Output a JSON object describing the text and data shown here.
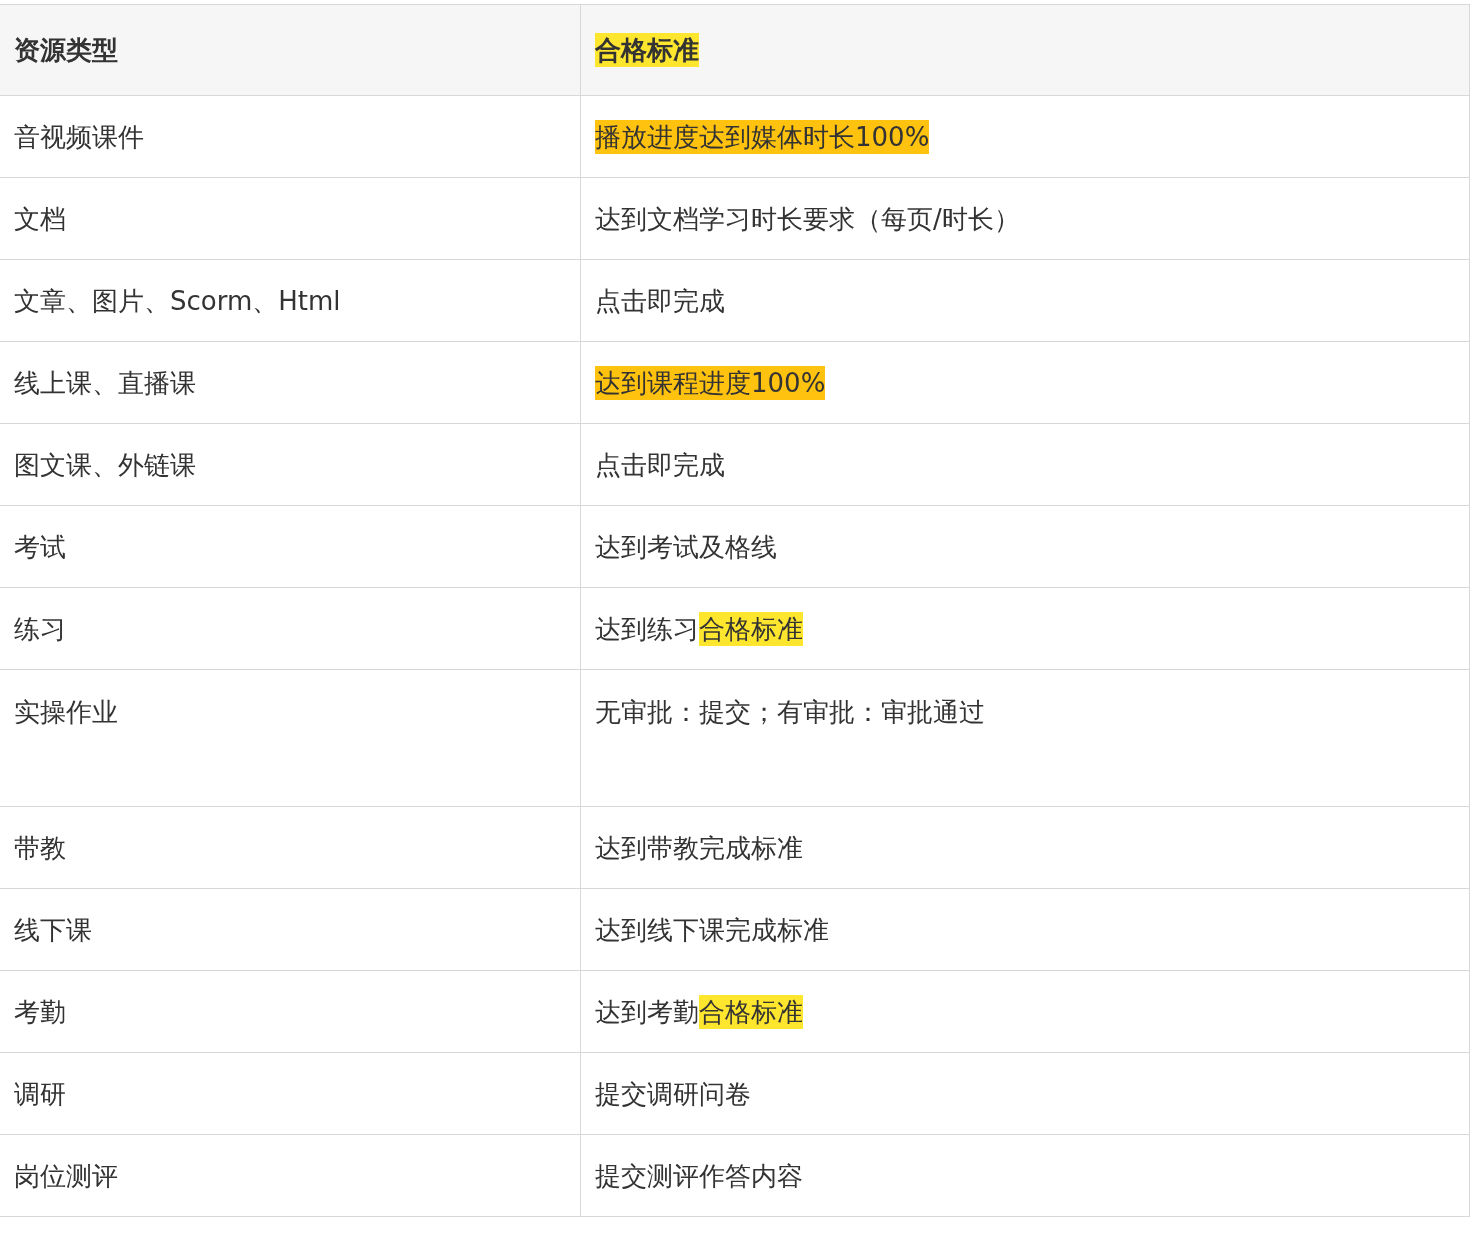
{
  "table": {
    "columns": [
      {
        "segments": [
          {
            "text": "资源类型"
          }
        ]
      },
      {
        "segments": [
          {
            "text": "合格标准",
            "color": "#ffe62e"
          }
        ]
      }
    ],
    "rows": [
      {
        "kind": "normal",
        "cells": [
          [
            {
              "text": "音视频课件"
            }
          ],
          [
            {
              "text": "播放进度达到媒体时长100%",
              "color": "#ffc20e"
            }
          ]
        ]
      },
      {
        "kind": "normal",
        "cells": [
          [
            {
              "text": "文档"
            }
          ],
          [
            {
              "text": "达到文档学习时长要求（每页/时长）"
            }
          ]
        ]
      },
      {
        "kind": "normal",
        "cells": [
          [
            {
              "text": "文章、图片、Scorm、Html"
            }
          ],
          [
            {
              "text": "点击即完成"
            }
          ]
        ]
      },
      {
        "kind": "normal",
        "cells": [
          [
            {
              "text": "线上课、直播课"
            }
          ],
          [
            {
              "text": "达到课程进度100%",
              "color": "#ffc20e"
            }
          ]
        ]
      },
      {
        "kind": "normal",
        "cells": [
          [
            {
              "text": "图文课、外链课"
            }
          ],
          [
            {
              "text": "点击即完成"
            }
          ]
        ]
      },
      {
        "kind": "normal",
        "cells": [
          [
            {
              "text": "考试"
            }
          ],
          [
            {
              "text": "达到考试及格线"
            }
          ]
        ]
      },
      {
        "kind": "normal",
        "cells": [
          [
            {
              "text": "练习"
            }
          ],
          [
            {
              "text": "达到练习"
            },
            {
              "text": "合格标准",
              "color": "#ffe62e"
            }
          ]
        ]
      },
      {
        "kind": "tall",
        "cells": [
          [
            {
              "text": "实操作业"
            }
          ],
          [
            {
              "text": "无审批：提交；有审批：审批通过"
            }
          ]
        ]
      },
      {
        "kind": "normal",
        "cells": [
          [
            {
              "text": "带教"
            }
          ],
          [
            {
              "text": "达到带教完成标准"
            }
          ]
        ]
      },
      {
        "kind": "normal",
        "cells": [
          [
            {
              "text": "线下课"
            }
          ],
          [
            {
              "text": "达到线下课完成标准"
            }
          ]
        ]
      },
      {
        "kind": "normal",
        "cells": [
          [
            {
              "text": "考勤"
            }
          ],
          [
            {
              "text": "达到考勤"
            },
            {
              "text": "合格标准",
              "color": "#ffe62e"
            }
          ]
        ]
      },
      {
        "kind": "normal",
        "cells": [
          [
            {
              "text": "调研"
            }
          ],
          [
            {
              "text": "提交调研问卷"
            }
          ]
        ]
      },
      {
        "kind": "normal",
        "cells": [
          [
            {
              "text": "岗位测评"
            }
          ],
          [
            {
              "text": "提交测评作答内容"
            }
          ]
        ]
      }
    ]
  }
}
